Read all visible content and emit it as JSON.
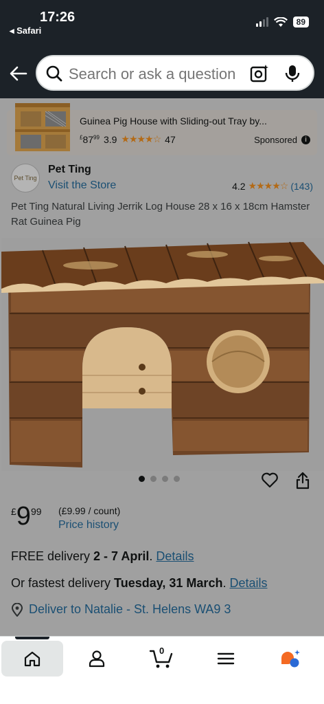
{
  "status_bar": {
    "time": "17:26",
    "back_app": "Safari",
    "battery": "89"
  },
  "search": {
    "placeholder": "Search or ask a question"
  },
  "sponsored_ad": {
    "title": "Guinea Pig House with Sliding-out Tray by...",
    "price_currency": "£",
    "price_whole": "87",
    "price_fraction": "99",
    "rating": "3.9",
    "stars": "★★★★☆",
    "review_count": "47",
    "sponsored_label": "Sponsored",
    "info_label": "i"
  },
  "store": {
    "logo_text": "Pet Ting",
    "name": "Pet Ting",
    "visit_link": "Visit the Store",
    "rating": "4.2",
    "stars": "★★★★☆",
    "rating_count": "(143)"
  },
  "product": {
    "title": "Pet Ting Natural Living Jerrik Log House 28 x 16 x 18cm Hamster Rat Guinea Pig",
    "image_count": 4,
    "image_index": 1
  },
  "pricing": {
    "currency": "£",
    "whole": "9",
    "fraction": "99",
    "unit_price": "(£9.99 / count)",
    "history_link": "Price history"
  },
  "delivery": {
    "free_prefix": "FREE delivery ",
    "free_dates": "2 - 7 April",
    "free_dot": ". ",
    "free_details": "Details",
    "fast_prefix": "Or fastest delivery ",
    "fast_date": "Tuesday, 31 March",
    "fast_dot": ". ",
    "fast_details": "Details",
    "deliver_to": "Deliver to Natalie - St. Helens WA9 3"
  },
  "bottom_nav": {
    "cart_count": "0"
  },
  "colors": {
    "header_bg": "#1c2228",
    "link": "#1a4f73",
    "star": "#b36a16",
    "assistant_orange": "#f46a23",
    "assistant_blue": "#2a6ad6"
  }
}
